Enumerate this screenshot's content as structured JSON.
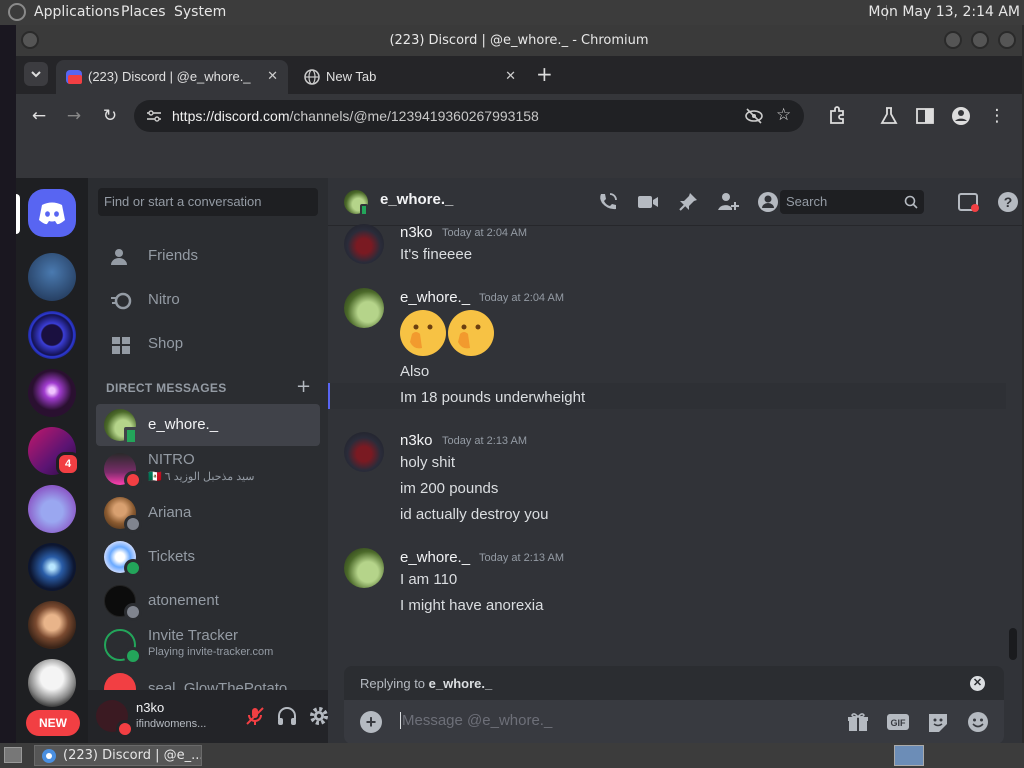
{
  "top_panel": {
    "menus": [
      "Applications",
      "Places",
      "System"
    ],
    "clock": "Mon May 13,  2:14 AM"
  },
  "window": {
    "title": "(223) Discord | @e_whore._ - Chromium"
  },
  "browser": {
    "tabs": [
      {
        "label": "(223) Discord | @e_whore._",
        "active": true,
        "favicon_badge": "223"
      },
      {
        "label": "New Tab",
        "active": false
      }
    ],
    "url_host": "https://discord.com",
    "url_path": "/channels/@me/1239419360267993158"
  },
  "discord": {
    "guild_badge_count": "4",
    "new_badge": "NEW",
    "dm_search_placeholder": "Find or start a conversation",
    "nav": [
      {
        "label": "Friends",
        "icon": "friends-icon"
      },
      {
        "label": "Nitro",
        "icon": "nitro-icon"
      },
      {
        "label": "Shop",
        "icon": "shop-icon"
      }
    ],
    "dm_header": "DIRECT MESSAGES",
    "dms": [
      {
        "name": "e_whore._",
        "sub": "",
        "selected": true,
        "status": "mobile"
      },
      {
        "name": "NITRO",
        "sub": "🇲🇽 سيد مذحبل الوزيد ٦",
        "selected": false,
        "status": "dnd"
      },
      {
        "name": "Ariana",
        "sub": "",
        "selected": false,
        "status": "offline"
      },
      {
        "name": "Tickets",
        "sub": "",
        "selected": false,
        "status": "online"
      },
      {
        "name": "atonement",
        "sub": "",
        "selected": false,
        "status": "offline"
      },
      {
        "name": "Invite Tracker",
        "sub": "Playing invite-tracker.com",
        "selected": false,
        "status": "online"
      },
      {
        "name": "seal, GlowThePotato, ...",
        "sub": "",
        "selected": false,
        "status": ""
      }
    ],
    "user": {
      "name": "n3ko",
      "status_text": "ifindwomens..."
    },
    "chat": {
      "recipient": "e_whore._",
      "search_placeholder": "Search",
      "messages": [
        {
          "author": "n3ko",
          "time": "Today at 2:04 AM",
          "lines": [
            "It's fineeee"
          ]
        },
        {
          "author": "e_whore._",
          "time": "Today at 2:04 AM",
          "emoji": "🤭🤭",
          "lines": [
            "Also",
            "Im 18 pounds underwheight"
          ]
        },
        {
          "author": "n3ko",
          "time": "Today at 2:13 AM",
          "lines": [
            "holy shit",
            "im 200 pounds",
            "id actually destroy you"
          ]
        },
        {
          "author": "e_whore._",
          "time": "Today at 2:13 AM",
          "lines": [
            "I am 110",
            "I might have anorexia"
          ]
        }
      ],
      "reply_prefix": "Replying to ",
      "reply_to": "e_whore._",
      "composer_placeholder": "Message @e_whore._"
    }
  },
  "taskbar": {
    "task_label": "(223) Discord | @e_..."
  },
  "colors": {
    "blurple": "#5865f2",
    "online": "#23a55a",
    "dnd": "#f23f43",
    "offline": "#80848e"
  }
}
